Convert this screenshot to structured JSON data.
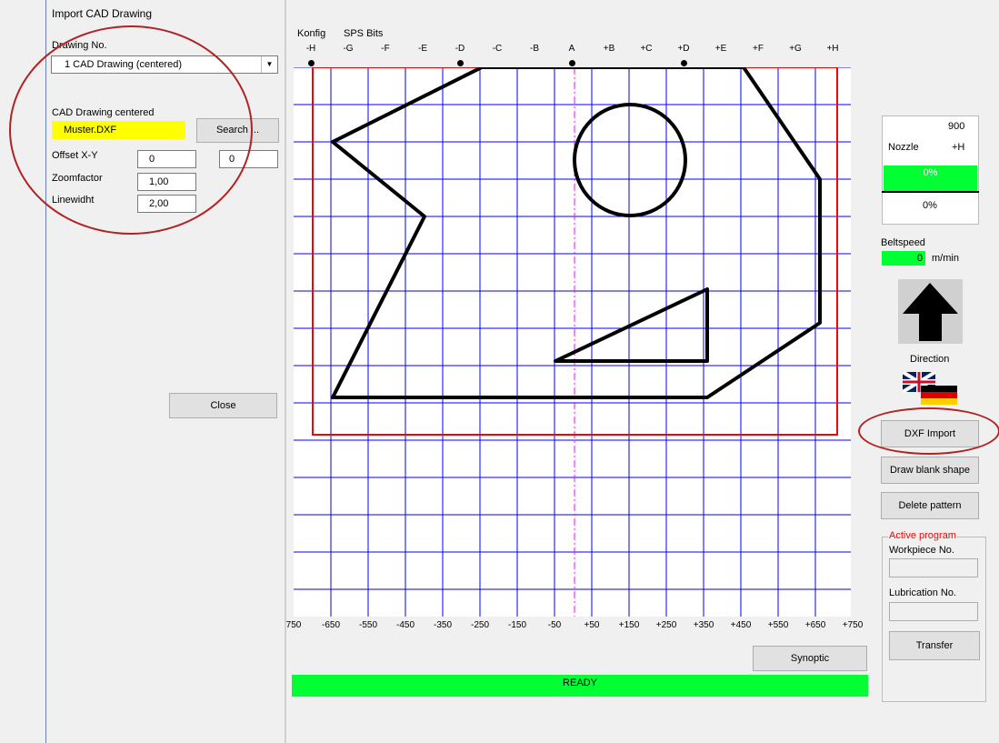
{
  "dialog": {
    "title": "Import CAD Drawing",
    "drawing_no_label": "Drawing No.",
    "drawing_select": "1 CAD Drawing (centered)",
    "cad_label": "CAD Drawing centered",
    "cad_file": "Muster.DXF",
    "search_button": "Search ...",
    "offset_label": "Offset X-Y",
    "offset_x": "0",
    "offset_y": "0",
    "zoom_label": "Zoomfactor",
    "zoom_value": "1,00",
    "linewidth_label": "Linewidht",
    "linewidth_value": "2,00",
    "close_button": "Close",
    "highlight_color": "#ffff00"
  },
  "menu": {
    "konfig": "Konfig",
    "sps_bits": "SPS Bits"
  },
  "grid": {
    "top_labels": [
      "-H",
      "-G",
      "-F",
      "-E",
      "-D",
      "-C",
      "-B",
      "A",
      "+B",
      "+C",
      "+D",
      "+E",
      "+F",
      "+G",
      "+H"
    ],
    "bottom_labels": [
      "750",
      "-650",
      "-550",
      "-450",
      "-350",
      "-250",
      "-150",
      "-50",
      "+50",
      "+150",
      "+250",
      "+350",
      "+450",
      "+550",
      "+650",
      "+750"
    ],
    "grid_color": "#0000ff",
    "border_color": "#ff0000",
    "centerline_color": "#ff00ff"
  },
  "right_panel": {
    "counter": "900",
    "nozzle_label": "Nozzle",
    "nozzle_value": "+H",
    "progress_top": "0%",
    "progress_bottom": "0%",
    "beltspeed_label": "Beltspeed",
    "beltspeed_value": "0",
    "beltspeed_unit": "m/min",
    "direction_label": "Direction",
    "dxf_import_button": "DXF Import",
    "draw_blank_button": "Draw blank shape",
    "delete_pattern_button": "Delete pattern",
    "active_program_label": "Active program",
    "workpiece_label": "Workpiece No.",
    "lubrication_label": "Lubrication No.",
    "transfer_button": "Transfer"
  },
  "synoptic_button": "Synoptic",
  "status": "READY",
  "status_color": "#00ff33",
  "annotation_color": "#b22222"
}
